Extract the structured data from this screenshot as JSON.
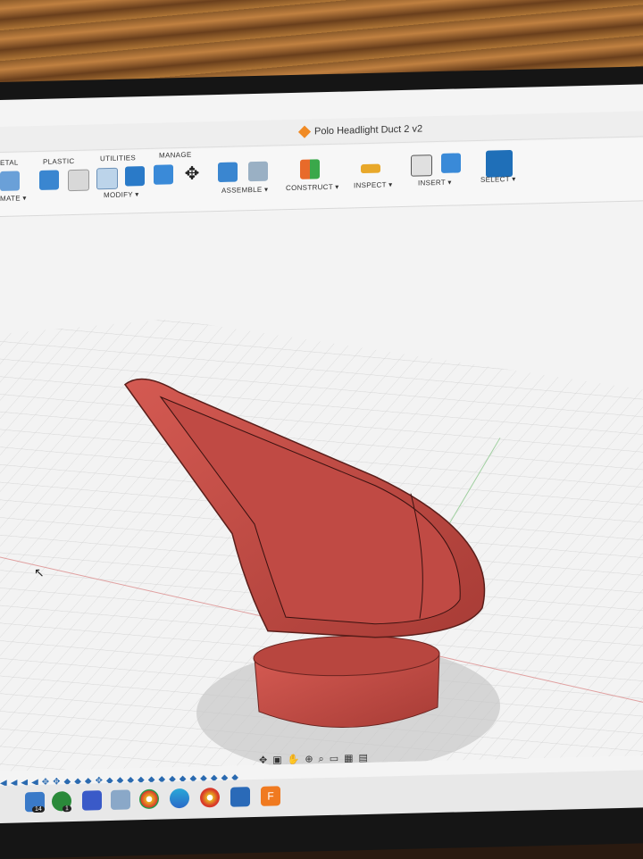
{
  "window": {
    "title": "Polo Headlight Duct 2 v2"
  },
  "toolbar": {
    "tabs": [
      "ETAL",
      "PLASTIC",
      "UTILITIES",
      "MANAGE"
    ],
    "groups": {
      "create_partial": "MATE ▾",
      "modify": "MODIFY ▾",
      "assemble": "ASSEMBLE ▾",
      "construct": "CONSTRUCT ▾",
      "inspect": "INSPECT ▾",
      "insert": "INSERT ▾",
      "select": "SELECT ▾"
    }
  },
  "icons": {
    "doc": "document-icon",
    "nav": [
      "orbit-icon",
      "look-at-icon",
      "pan-icon",
      "zoom-icon",
      "fit-icon",
      "display-settings-icon",
      "grid-icon",
      "viewports-icon"
    ]
  },
  "taskbar": {
    "badges": [
      "14",
      "1"
    ]
  },
  "colors": {
    "model": "#c8504a",
    "model_dark": "#8f2e2a",
    "grid_line": "#d6d6d6",
    "accent": "#2a6ab0"
  }
}
